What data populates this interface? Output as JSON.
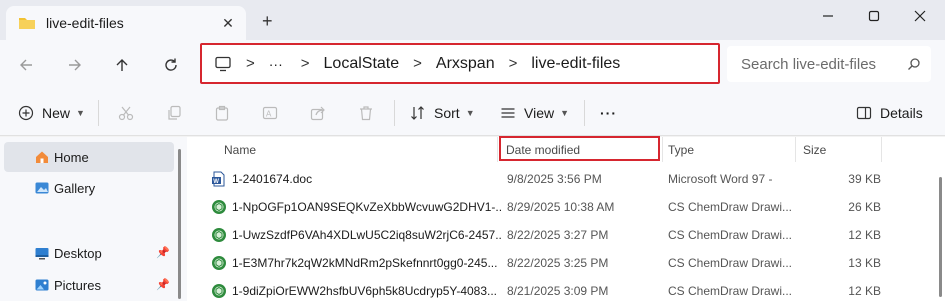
{
  "window": {
    "tab_title": "live-edit-files",
    "new_tab": "+",
    "minimize_icon": "minimize-icon",
    "maximize_icon": "maximize-icon",
    "close_icon": "close-icon"
  },
  "address": {
    "ellipsis": "···",
    "separator": ">",
    "crumbs": [
      "LocalState",
      "Arxspan",
      "live-edit-files"
    ],
    "search_placeholder": "Search live-edit-files"
  },
  "toolbar": {
    "new_label": "New",
    "sort_label": "Sort",
    "view_label": "View",
    "more_label": "···",
    "details_label": "Details"
  },
  "sidebar": {
    "items": [
      {
        "label": "Home",
        "icon": "home-icon",
        "selected": true
      },
      {
        "label": "Gallery",
        "icon": "gallery-icon"
      },
      {
        "label": "Desktop",
        "icon": "desktop-icon",
        "pinned": true
      },
      {
        "label": "Pictures",
        "icon": "pictures-icon",
        "pinned": true
      }
    ]
  },
  "columns": {
    "name": "Name",
    "date": "Date modified",
    "type": "Type",
    "size": "Size"
  },
  "files": [
    {
      "name": "1-2401674.doc",
      "date": "9/8/2025 3:56 PM",
      "type": "Microsoft Word 97 -",
      "size": "39 KB",
      "icon": "word-doc-icon"
    },
    {
      "name": "1-NpOGFp1OAN9SEQKvZeXbbWcvuwG2DHV1-...",
      "date": "8/29/2025 10:38 AM",
      "type": "CS ChemDraw Drawi...",
      "size": "26 KB",
      "icon": "chemdraw-icon"
    },
    {
      "name": "1-UwzSzdfP6VAh4XDLwU5C2iq8suW2rjC6-2457...",
      "date": "8/22/2025 3:27 PM",
      "type": "CS ChemDraw Drawi...",
      "size": "12 KB",
      "icon": "chemdraw-icon"
    },
    {
      "name": "1-E3M7hr7k2qW2kMNdRm2pSkefnnrt0gg0-245...",
      "date": "8/22/2025 3:25 PM",
      "type": "CS ChemDraw Drawi...",
      "size": "13 KB",
      "icon": "chemdraw-icon"
    },
    {
      "name": "1-9diZpiOrEWW2hsfbUV6ph5k8Ucdryp5Y-4083...",
      "date": "8/21/2025 3:09 PM",
      "type": "CS ChemDraw Drawi...",
      "size": "12 KB",
      "icon": "chemdraw-icon"
    }
  ],
  "colors": {
    "highlight_red": "#d6262f",
    "folder_yellow": "#f2c232",
    "chemdraw_green": "#2e8b3d",
    "word_blue": "#2b579a"
  }
}
